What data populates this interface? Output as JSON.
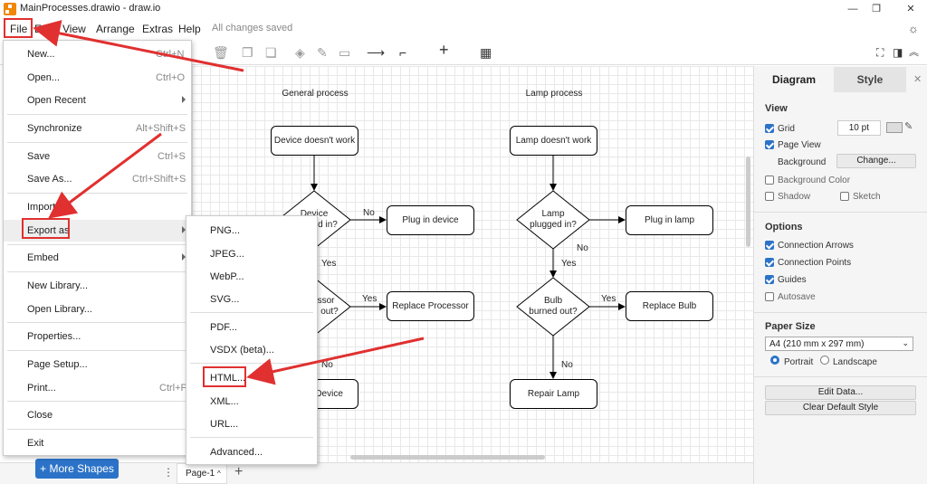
{
  "window": {
    "title": "MainProcesses.drawio - draw.io",
    "minimize": "—",
    "restore": "❐",
    "close": "✕"
  },
  "menubar": {
    "items": [
      "File",
      "Edit",
      "View",
      "Arrange",
      "Extras",
      "Help"
    ],
    "status": "All changes saved"
  },
  "toolbar": {
    "icons": [
      "trash-icon",
      "to-front-icon",
      "to-back-icon",
      "fill-color-icon",
      "line-color-icon",
      "shadow-icon",
      "connection-icon",
      "waypoints-icon",
      "insert-icon",
      "table-icon"
    ]
  },
  "file_menu": {
    "items": [
      {
        "label": "New...",
        "shortcut": "Ctrl+N"
      },
      {
        "label": "Open...",
        "shortcut": "Ctrl+O"
      },
      {
        "label": "Open Recent",
        "shortcut": ""
      },
      {
        "label": "Synchronize",
        "shortcut": "Alt+Shift+S"
      },
      {
        "label": "Save",
        "shortcut": "Ctrl+S"
      },
      {
        "label": "Save As...",
        "shortcut": "Ctrl+Shift+S"
      },
      {
        "label": "Import",
        "shortcut": ""
      },
      {
        "label": "Export as",
        "shortcut": ""
      },
      {
        "label": "Embed",
        "shortcut": ""
      },
      {
        "label": "New Library...",
        "shortcut": ""
      },
      {
        "label": "Open Library...",
        "shortcut": ""
      },
      {
        "label": "Properties...",
        "shortcut": ""
      },
      {
        "label": "Page Setup...",
        "shortcut": ""
      },
      {
        "label": "Print...",
        "shortcut": "Ctrl+P"
      },
      {
        "label": "Close",
        "shortcut": ""
      },
      {
        "label": "Exit",
        "shortcut": ""
      }
    ]
  },
  "export_menu": {
    "items": [
      "PNG...",
      "JPEG...",
      "WebP...",
      "SVG...",
      "PDF...",
      "VSDX (beta)...",
      "HTML...",
      "XML...",
      "URL...",
      "Advanced..."
    ]
  },
  "diagram": {
    "general_title": "General process",
    "lamp_title": "Lamp process",
    "general": {
      "start": "Device doesn't work",
      "decision1": "Device\nplugged in?",
      "action1": "Plug in device",
      "decision2": "Processor\nburned out?",
      "action2": "Replace Processor",
      "end": "Repair Device"
    },
    "lamp": {
      "start": "Lamp doesn't work",
      "decision1": "Lamp\nplugged in?",
      "action1": "Plug in lamp",
      "decision2": "Bulb\nburned out?",
      "action2": "Replace Bulb",
      "end": "Repair Lamp"
    },
    "yes": "Yes",
    "no": "No"
  },
  "panel": {
    "tabs": [
      "Diagram",
      "Style"
    ],
    "view_title": "View",
    "grid_label": "Grid",
    "grid_size": "10 pt",
    "page_view_label": "Page View",
    "background_label": "Background",
    "change_button": "Change...",
    "background_color_label": "Background Color",
    "shadow_label": "Shadow",
    "sketch_label": "Sketch",
    "options_title": "Options",
    "connection_arrows": "Connection Arrows",
    "connection_points": "Connection Points",
    "guides": "Guides",
    "autosave": "Autosave",
    "paper_size_title": "Paper Size",
    "paper_size_value": "A4 (210 mm x 297 mm)",
    "portrait": "Portrait",
    "landscape": "Landscape",
    "edit_data": "Edit Data...",
    "clear_default_style": "Clear Default Style"
  },
  "bottom": {
    "more_shapes": "More Shapes",
    "page_tab": "Page-1"
  },
  "colors": {
    "accent": "#2c73c8",
    "annotation_red": "#e03030"
  }
}
